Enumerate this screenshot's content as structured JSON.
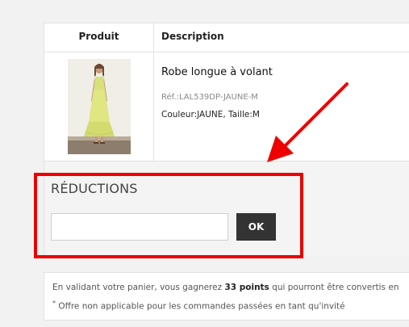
{
  "table": {
    "headers": {
      "product": "Produit",
      "description": "Description"
    },
    "items": [
      {
        "title": "Robe longue à volant",
        "ref": "Réf.:LAL539DP-JAUNE-M",
        "variant": "Couleur:JAUNE, Taille:M",
        "image_icon": "yellow-dress-photo"
      }
    ]
  },
  "reductions": {
    "title": "RÉDUCTIONS",
    "input_value": "",
    "input_placeholder": "",
    "ok_label": "OK"
  },
  "info": {
    "points_text_before": "En validant votre panier, vous gagnerez ",
    "points_value": "33 points",
    "points_text_after": " qui pourront être convertis en",
    "note_marker": "*",
    "note_text": " Offre non applicable pour les commandes passées en tant qu'invité"
  },
  "annotations": {
    "highlight_color": "#ee0000"
  },
  "colors": {
    "button_bg": "#333333",
    "page_bg": "#f2f2f2"
  }
}
